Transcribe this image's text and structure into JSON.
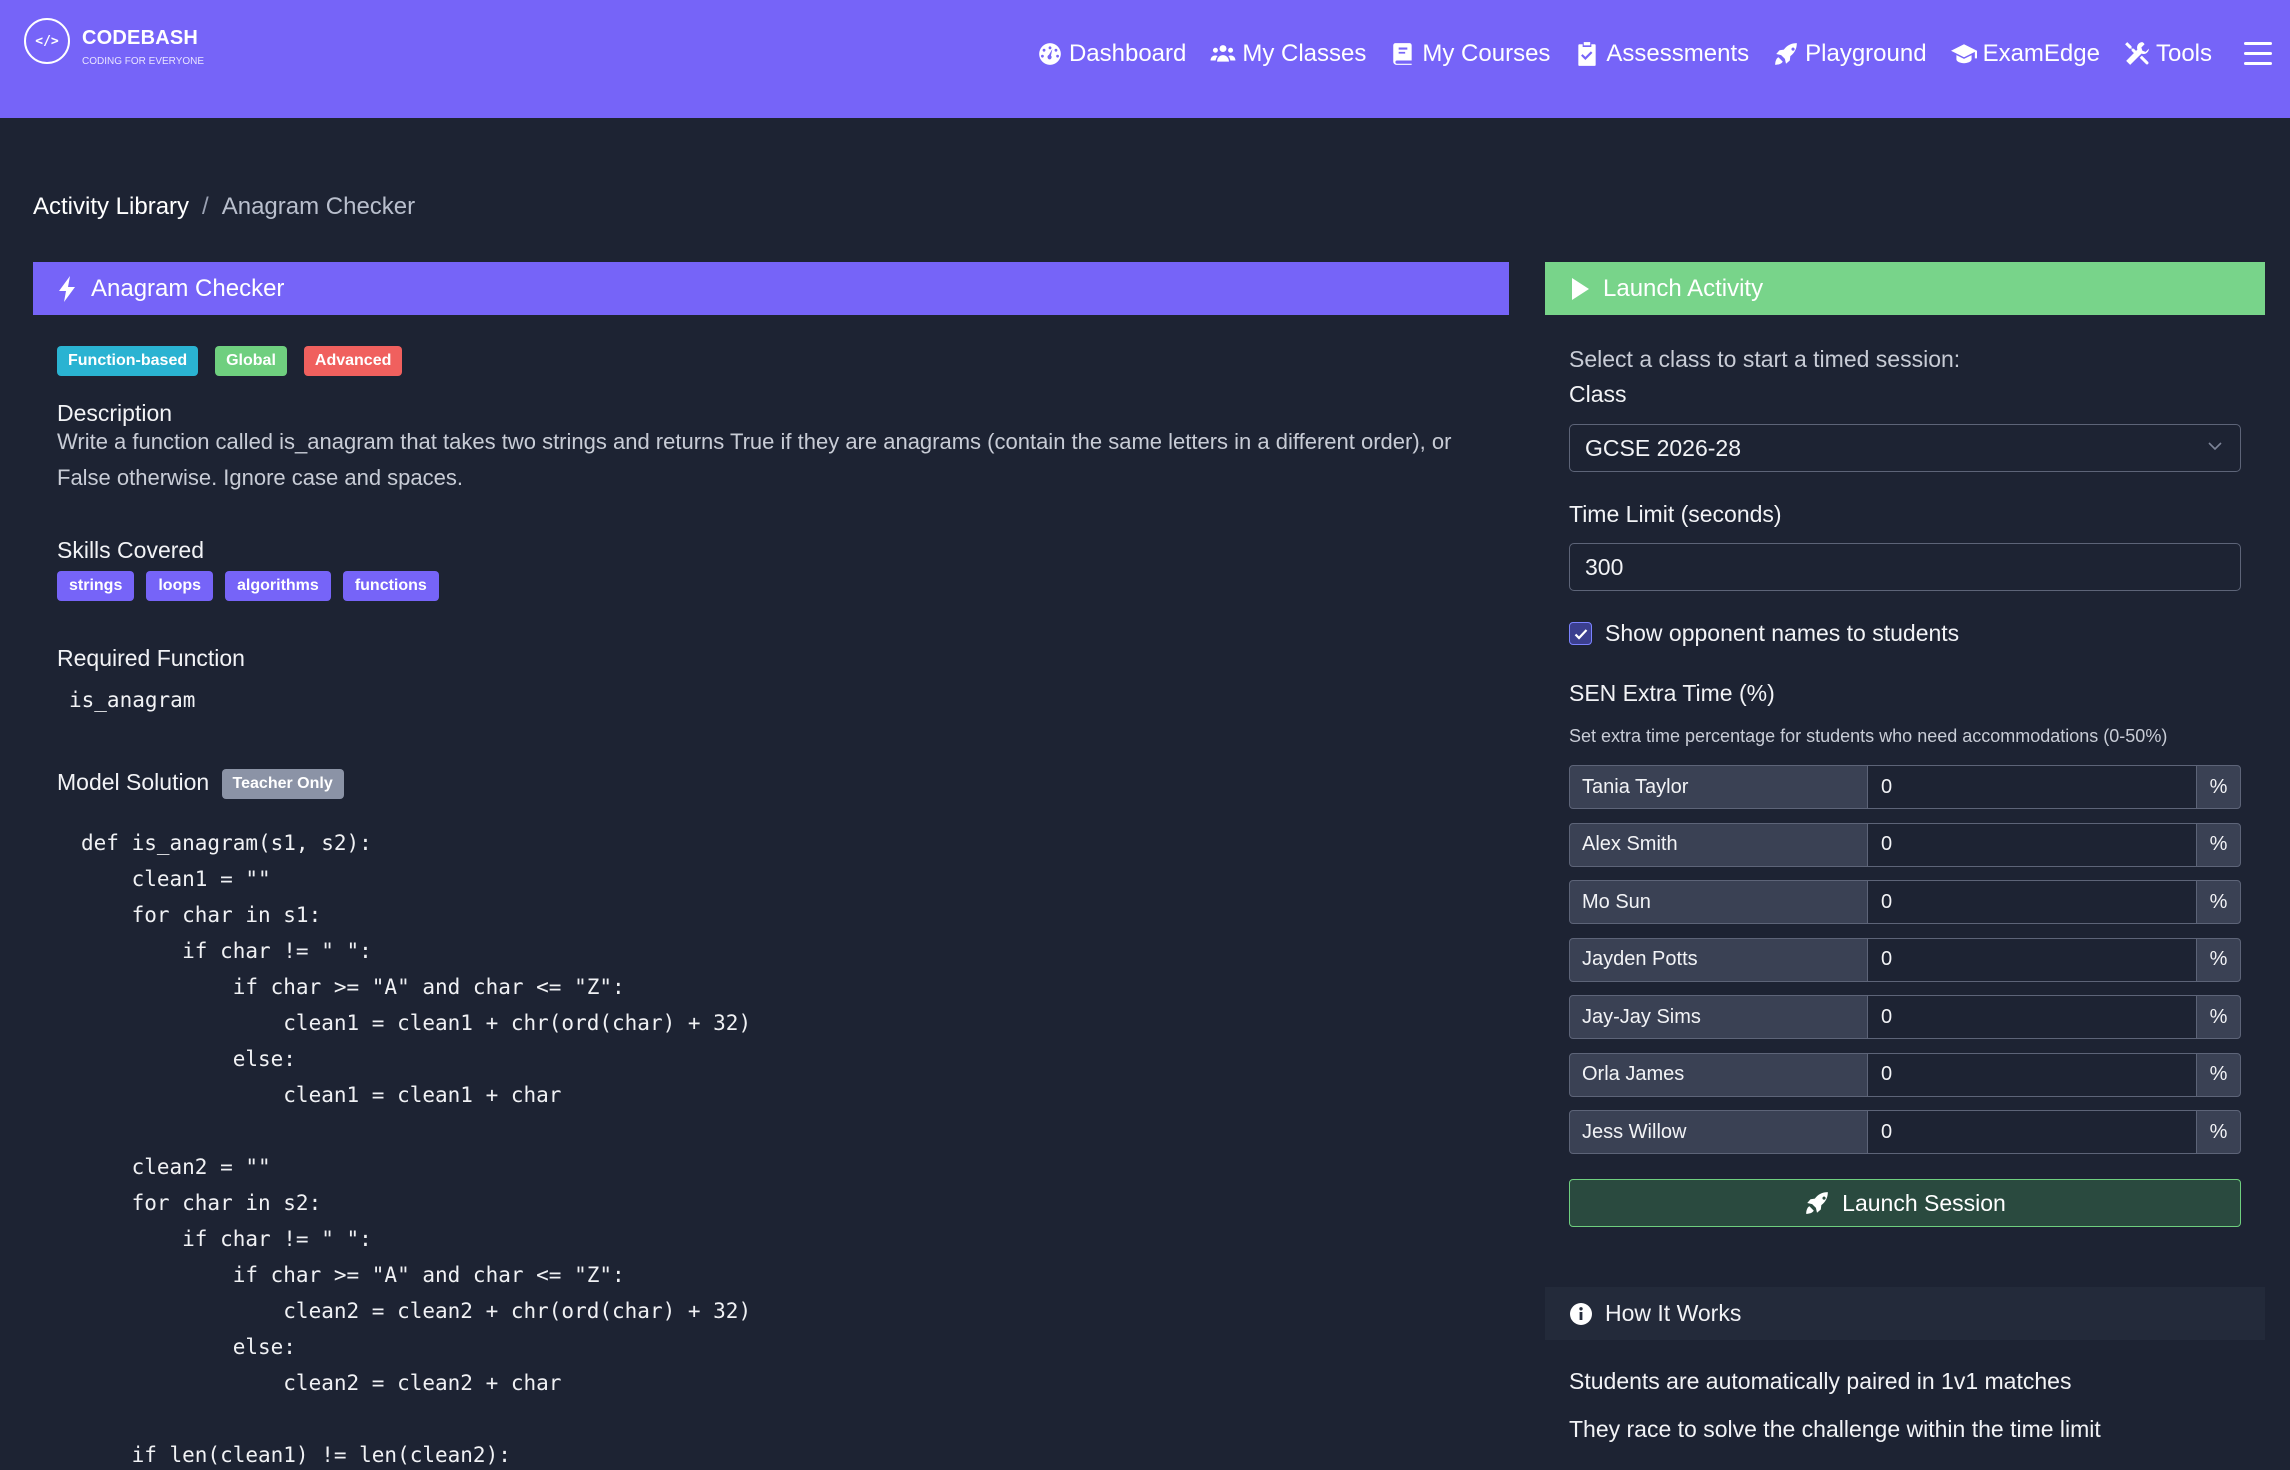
{
  "brand": {
    "logo": "</>",
    "name": "CODEBASH",
    "tagline": "CODING FOR EVERYONE"
  },
  "nav": {
    "items": [
      {
        "label": "Dashboard",
        "icon": "gauge-icon"
      },
      {
        "label": "My Classes",
        "icon": "users-icon"
      },
      {
        "label": "My Courses",
        "icon": "book-icon"
      },
      {
        "label": "Assessments",
        "icon": "clipboard-check-icon"
      },
      {
        "label": "Playground",
        "icon": "rocket-icon"
      },
      {
        "label": "ExamEdge",
        "icon": "graduation-cap-icon"
      },
      {
        "label": "Tools",
        "icon": "tools-icon"
      }
    ],
    "menu_icon": "hamburger-icon"
  },
  "breadcrumb": {
    "parent": "Activity Library",
    "separator": "/",
    "current": "Anagram Checker"
  },
  "activity": {
    "title": "Anagram Checker",
    "badges": [
      "Function-based",
      "Global",
      "Advanced"
    ],
    "description_label": "Description",
    "description": "Write a function called is_anagram that takes two strings and returns True if they are anagrams (contain the same letters in a different order), or False otherwise. Ignore case and spaces.",
    "skills_label": "Skills Covered",
    "skills": [
      "strings",
      "loops",
      "algorithms",
      "functions"
    ],
    "required_function_label": "Required Function",
    "required_function": "is_anagram",
    "model_solution_label": "Model Solution",
    "teacher_only_badge": "Teacher Only",
    "model_solution_code": "def is_anagram(s1, s2):\n    clean1 = \"\"\n    for char in s1:\n        if char != \" \":\n            if char >= \"A\" and char <= \"Z\":\n                clean1 = clean1 + chr(ord(char) + 32)\n            else:\n                clean1 = clean1 + char\n\n    clean2 = \"\"\n    for char in s2:\n        if char != \" \":\n            if char >= \"A\" and char <= \"Z\":\n                clean2 = clean2 + chr(ord(char) + 32)\n            else:\n                clean2 = clean2 + char\n\n    if len(clean1) != len(clean2):"
  },
  "launch": {
    "header": "Launch Activity",
    "intro": "Select a class to start a timed session:",
    "class_label": "Class",
    "class_value": "GCSE 2026-28",
    "time_limit_label": "Time Limit (seconds)",
    "time_limit_value": "300",
    "show_names_label": "Show opponent names to students",
    "show_names_checked": true,
    "sen_label": "SEN Extra Time (%)",
    "sen_help": "Set extra time percentage for students who need accommodations (0-50%)",
    "students": [
      {
        "name": "Tania Taylor",
        "value": "0"
      },
      {
        "name": "Alex Smith",
        "value": "0"
      },
      {
        "name": "Mo Sun",
        "value": "0"
      },
      {
        "name": "Jayden Potts",
        "value": "0"
      },
      {
        "name": "Jay-Jay Sims",
        "value": "0"
      },
      {
        "name": "Orla James",
        "value": "0"
      },
      {
        "name": "Jess Willow",
        "value": "0"
      }
    ],
    "percent_symbol": "%",
    "button_label": "Launch Session"
  },
  "how_it_works": {
    "title": "How It Works",
    "lines": [
      "Students are automatically paired in 1v1 matches",
      "They race to solve the challenge within the time limit"
    ]
  },
  "colors": {
    "primary": "#7664f8",
    "success": "#78d48a",
    "background": "#1d2333",
    "badge_cyan": "#2ab3d2",
    "badge_green": "#6fcf7f",
    "badge_red": "#f0605e",
    "badge_gray": "#8b93a6"
  }
}
